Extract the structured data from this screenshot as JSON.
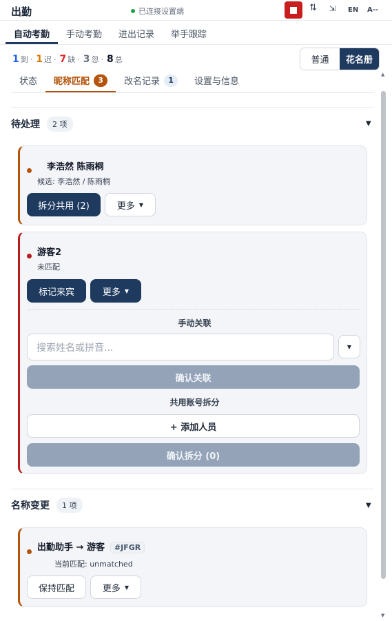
{
  "app": {
    "title": "出勤",
    "status": "已连接设置端"
  },
  "toolbar": {
    "sort_icon": "⇅",
    "minimize_icon": "⇲",
    "lang": "EN",
    "font": "A--"
  },
  "tabs": [
    "自动考勤",
    "手动考勤",
    "进出记录",
    "举手跟踪"
  ],
  "stats": {
    "present": {
      "value": "1",
      "label": "到",
      "color": "#2563eb"
    },
    "late": {
      "value": "1",
      "label": "迟",
      "color": "#d97706"
    },
    "absent": {
      "value": "7",
      "label": "缺",
      "color": "#dc2626"
    },
    "ignored": {
      "value": "3",
      "label": "忽",
      "color": "#6b7280"
    },
    "total": {
      "value": "8",
      "label": "总",
      "color": "#111827"
    }
  },
  "view_toggle": {
    "normal": "普通",
    "roster": "花名册"
  },
  "subtabs": [
    {
      "label": "状态"
    },
    {
      "label": "昵称匹配",
      "count": "3"
    },
    {
      "label": "改名记录",
      "count": "1"
    },
    {
      "label": "设置与信息"
    }
  ],
  "pending": {
    "title": "待处理",
    "count": "2 项",
    "card1": {
      "name": "李浩然 陈雨桐",
      "sub": "候选: 李浩然 / 陈雨桐",
      "split_btn": "拆分共用 (2)",
      "more_btn": "更多"
    },
    "card2": {
      "name": "游客2",
      "sub": "未匹配",
      "mark_btn": "标记来宾",
      "more_btn": "更多",
      "manual_head": "手动关联",
      "search_placeholder": "搜索姓名或拼音...",
      "confirm_link": "确认关联",
      "split_head": "共用账号拆分",
      "add_person": "+ 添加人员",
      "confirm_split": "确认拆分 (0)"
    }
  },
  "rename": {
    "title": "名称变更",
    "count": "1 项",
    "card": {
      "name": "出勤助手 → 游客",
      "tag": "#JFGR",
      "sub": "当前匹配: unmatched",
      "keep_btn": "保持匹配",
      "more_btn": "更多"
    }
  }
}
